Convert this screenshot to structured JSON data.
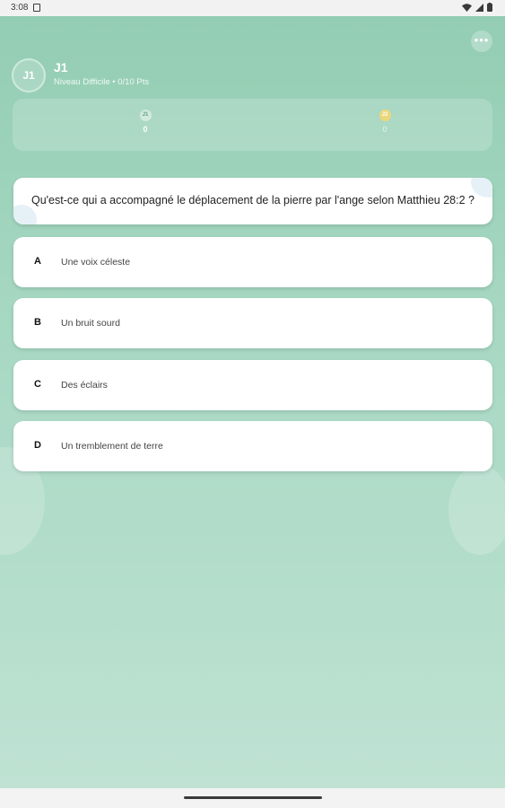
{
  "status_bar": {
    "time": "3:08"
  },
  "header": {
    "more_label": "•••",
    "avatar_initials": "J1",
    "player_name": "J1",
    "subtitle": "Niveau Difficile • 0/10 Pts"
  },
  "players": [
    {
      "initials": "J1",
      "score": "0"
    },
    {
      "initials": "J2",
      "score": "0"
    }
  ],
  "question": {
    "text": "Qu'est-ce qui a accompagné le déplacement de la pierre par l'ange selon Matthieu 28:2 ?"
  },
  "answers": [
    {
      "letter": "A",
      "text": "Une voix céleste"
    },
    {
      "letter": "B",
      "text": "Un bruit sourd"
    },
    {
      "letter": "C",
      "text": "Des éclairs"
    },
    {
      "letter": "D",
      "text": "Un tremblement de terre"
    }
  ]
}
